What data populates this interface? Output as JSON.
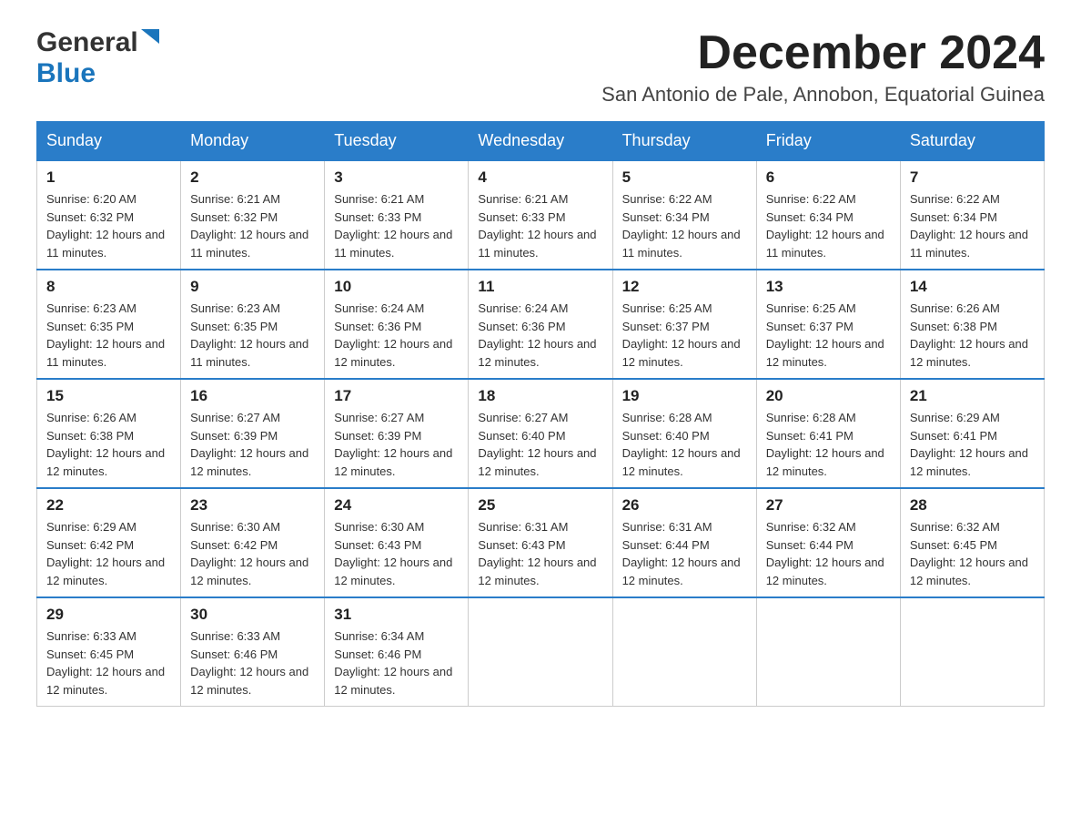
{
  "logo": {
    "general": "General",
    "blue": "Blue"
  },
  "header": {
    "title": "December 2024",
    "location": "San Antonio de Pale, Annobon, Equatorial Guinea"
  },
  "days_of_week": [
    "Sunday",
    "Monday",
    "Tuesday",
    "Wednesday",
    "Thursday",
    "Friday",
    "Saturday"
  ],
  "weeks": [
    [
      {
        "day": "1",
        "sunrise": "6:20 AM",
        "sunset": "6:32 PM",
        "daylight": "12 hours and 11 minutes."
      },
      {
        "day": "2",
        "sunrise": "6:21 AM",
        "sunset": "6:32 PM",
        "daylight": "12 hours and 11 minutes."
      },
      {
        "day": "3",
        "sunrise": "6:21 AM",
        "sunset": "6:33 PM",
        "daylight": "12 hours and 11 minutes."
      },
      {
        "day": "4",
        "sunrise": "6:21 AM",
        "sunset": "6:33 PM",
        "daylight": "12 hours and 11 minutes."
      },
      {
        "day": "5",
        "sunrise": "6:22 AM",
        "sunset": "6:34 PM",
        "daylight": "12 hours and 11 minutes."
      },
      {
        "day": "6",
        "sunrise": "6:22 AM",
        "sunset": "6:34 PM",
        "daylight": "12 hours and 11 minutes."
      },
      {
        "day": "7",
        "sunrise": "6:22 AM",
        "sunset": "6:34 PM",
        "daylight": "12 hours and 11 minutes."
      }
    ],
    [
      {
        "day": "8",
        "sunrise": "6:23 AM",
        "sunset": "6:35 PM",
        "daylight": "12 hours and 11 minutes."
      },
      {
        "day": "9",
        "sunrise": "6:23 AM",
        "sunset": "6:35 PM",
        "daylight": "12 hours and 11 minutes."
      },
      {
        "day": "10",
        "sunrise": "6:24 AM",
        "sunset": "6:36 PM",
        "daylight": "12 hours and 12 minutes."
      },
      {
        "day": "11",
        "sunrise": "6:24 AM",
        "sunset": "6:36 PM",
        "daylight": "12 hours and 12 minutes."
      },
      {
        "day": "12",
        "sunrise": "6:25 AM",
        "sunset": "6:37 PM",
        "daylight": "12 hours and 12 minutes."
      },
      {
        "day": "13",
        "sunrise": "6:25 AM",
        "sunset": "6:37 PM",
        "daylight": "12 hours and 12 minutes."
      },
      {
        "day": "14",
        "sunrise": "6:26 AM",
        "sunset": "6:38 PM",
        "daylight": "12 hours and 12 minutes."
      }
    ],
    [
      {
        "day": "15",
        "sunrise": "6:26 AM",
        "sunset": "6:38 PM",
        "daylight": "12 hours and 12 minutes."
      },
      {
        "day": "16",
        "sunrise": "6:27 AM",
        "sunset": "6:39 PM",
        "daylight": "12 hours and 12 minutes."
      },
      {
        "day": "17",
        "sunrise": "6:27 AM",
        "sunset": "6:39 PM",
        "daylight": "12 hours and 12 minutes."
      },
      {
        "day": "18",
        "sunrise": "6:27 AM",
        "sunset": "6:40 PM",
        "daylight": "12 hours and 12 minutes."
      },
      {
        "day": "19",
        "sunrise": "6:28 AM",
        "sunset": "6:40 PM",
        "daylight": "12 hours and 12 minutes."
      },
      {
        "day": "20",
        "sunrise": "6:28 AM",
        "sunset": "6:41 PM",
        "daylight": "12 hours and 12 minutes."
      },
      {
        "day": "21",
        "sunrise": "6:29 AM",
        "sunset": "6:41 PM",
        "daylight": "12 hours and 12 minutes."
      }
    ],
    [
      {
        "day": "22",
        "sunrise": "6:29 AM",
        "sunset": "6:42 PM",
        "daylight": "12 hours and 12 minutes."
      },
      {
        "day": "23",
        "sunrise": "6:30 AM",
        "sunset": "6:42 PM",
        "daylight": "12 hours and 12 minutes."
      },
      {
        "day": "24",
        "sunrise": "6:30 AM",
        "sunset": "6:43 PM",
        "daylight": "12 hours and 12 minutes."
      },
      {
        "day": "25",
        "sunrise": "6:31 AM",
        "sunset": "6:43 PM",
        "daylight": "12 hours and 12 minutes."
      },
      {
        "day": "26",
        "sunrise": "6:31 AM",
        "sunset": "6:44 PM",
        "daylight": "12 hours and 12 minutes."
      },
      {
        "day": "27",
        "sunrise": "6:32 AM",
        "sunset": "6:44 PM",
        "daylight": "12 hours and 12 minutes."
      },
      {
        "day": "28",
        "sunrise": "6:32 AM",
        "sunset": "6:45 PM",
        "daylight": "12 hours and 12 minutes."
      }
    ],
    [
      {
        "day": "29",
        "sunrise": "6:33 AM",
        "sunset": "6:45 PM",
        "daylight": "12 hours and 12 minutes."
      },
      {
        "day": "30",
        "sunrise": "6:33 AM",
        "sunset": "6:46 PM",
        "daylight": "12 hours and 12 minutes."
      },
      {
        "day": "31",
        "sunrise": "6:34 AM",
        "sunset": "6:46 PM",
        "daylight": "12 hours and 12 minutes."
      },
      null,
      null,
      null,
      null
    ]
  ]
}
